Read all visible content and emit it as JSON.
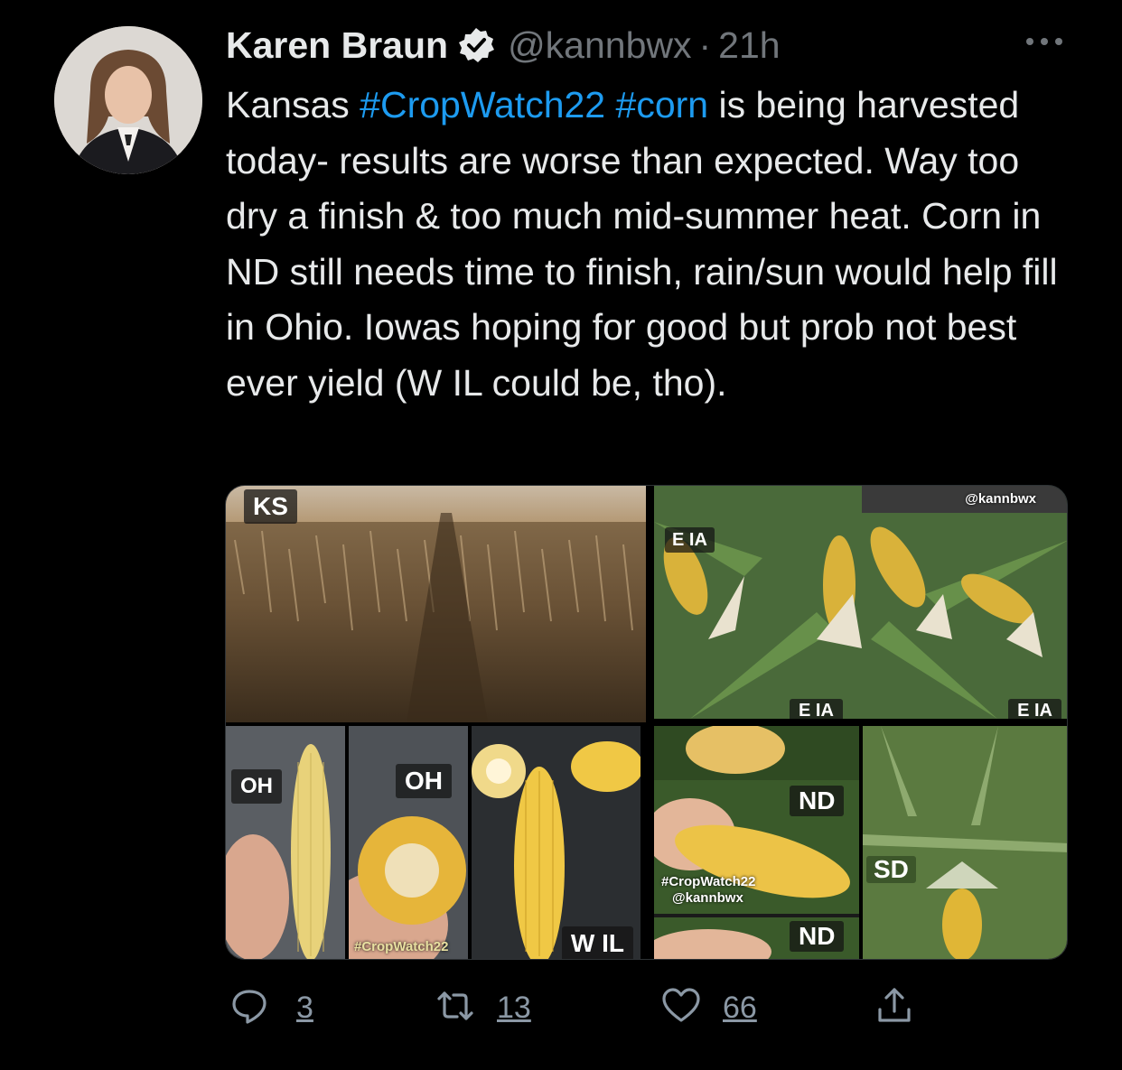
{
  "tweet": {
    "author_name": "Karen Braun",
    "handle": "@kannbwx",
    "separator": "·",
    "time": "21h",
    "text_parts": [
      {
        "text": "Kansas ",
        "tag": false
      },
      {
        "text": "#CropWatch22",
        "tag": true
      },
      {
        "text": " ",
        "tag": false
      },
      {
        "text": "#corn",
        "tag": true
      },
      {
        "text": " is being harvested today- results are worse than expected. Way too dry a finish & too much mid-summer heat. Corn in ND still needs time to finish, rain/sun would help fill in Ohio. Iowas hoping for good but prob not best ever yield (W IL could be, tho).",
        "tag": false
      }
    ]
  },
  "media": {
    "labels": {
      "ks": "KS",
      "eia_top": "E IA",
      "eia_bottom_1": "E IA",
      "eia_bottom_2": "E IA",
      "oh_1": "OH",
      "oh_2": "OH",
      "wil": "W IL",
      "nd_1": "ND",
      "nd_2": "ND",
      "sd": "SD"
    },
    "watermarks": {
      "kannbwx_top": "@kannbwx",
      "cropwatch_oh": "#CropWatch22",
      "cropwatch_nd": "#CropWatch22",
      "kannbwx_nd": "@kannbwx"
    }
  },
  "actions": {
    "reply_count": "3",
    "retweet_count": "13",
    "like_count": "66"
  },
  "colors": {
    "background": "#000000",
    "text": "#e7e9ea",
    "secondary": "#71767b",
    "link": "#1d9bf0"
  },
  "icons": {
    "verified": "verified-badge-icon",
    "more": "more-dots-icon",
    "reply": "reply-icon",
    "retweet": "retweet-icon",
    "like": "heart-icon",
    "share": "share-icon"
  }
}
